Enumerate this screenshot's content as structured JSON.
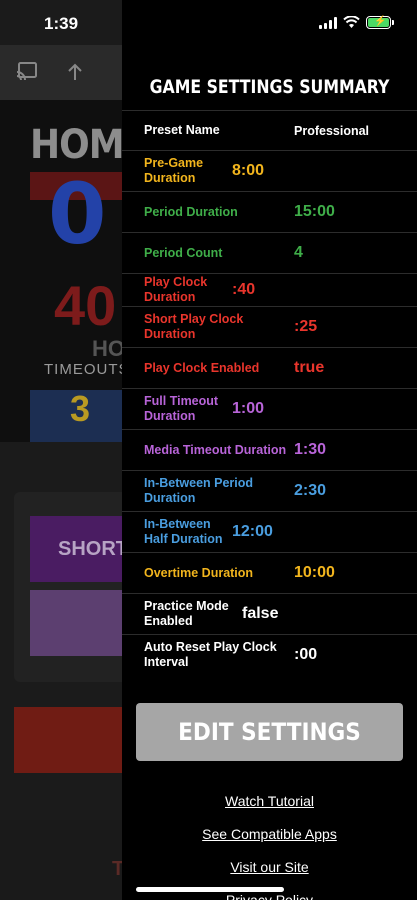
{
  "status_bar": {
    "time": "1:39",
    "icons": [
      "signal-icon",
      "wifi-icon",
      "battery-charging-icon"
    ],
    "battery_color": "#4cd964"
  },
  "background_app": {
    "toolbar_icons": [
      "cast-icon",
      "share-icon"
    ],
    "team_label": "HOME",
    "score": "0",
    "play_clock": "40",
    "partial_label": "HO",
    "timeouts_label": "TIMEOUTS",
    "timeouts_value": "3",
    "short_button_label": "SHORT W",
    "bottom_partial": "T"
  },
  "drawer": {
    "title": "GAME SETTINGS SUMMARY",
    "rows": [
      {
        "label": "Preset Name",
        "value": "Professional",
        "color": "white",
        "header": true
      },
      {
        "label": "Pre-Game Duration",
        "value": "8:00",
        "color": "yellow"
      },
      {
        "label": "Period Duration",
        "value": "15:00",
        "color": "green"
      },
      {
        "label": "Period Count",
        "value": "4",
        "color": "green"
      },
      {
        "label": "Play Clock Duration",
        "value": ":40",
        "color": "red"
      },
      {
        "label": "Short Play Clock Duration",
        "value": ":25",
        "color": "red"
      },
      {
        "label": "Play Clock Enabled",
        "value": "true",
        "color": "red"
      },
      {
        "label": "Full Timeout Duration",
        "value": "1:00",
        "color": "purple"
      },
      {
        "label": "Media Timeout Duration",
        "value": "1:30",
        "color": "purple"
      },
      {
        "label": "In-Between Period Duration",
        "value": "2:30",
        "color": "blue"
      },
      {
        "label": "In-Between Half Duration",
        "value": "12:00",
        "color": "blue"
      },
      {
        "label": "Overtime Duration",
        "value": "10:00",
        "color": "yellow"
      },
      {
        "label": "Practice Mode Enabled",
        "value": "false",
        "color": "white"
      },
      {
        "label": "Auto Reset Play Clock Interval",
        "value": ":00",
        "color": "white"
      }
    ],
    "colors": {
      "white": "#ffffff",
      "yellow": "#f2b51d",
      "green": "#3fae49",
      "red": "#e9352c",
      "purple": "#b864d8",
      "blue": "#4a9ee0"
    },
    "edit_button_label": "EDIT SETTINGS",
    "links": [
      "Watch Tutorial",
      "See Compatible Apps",
      "Visit our Site",
      "Privacy Policy"
    ]
  }
}
